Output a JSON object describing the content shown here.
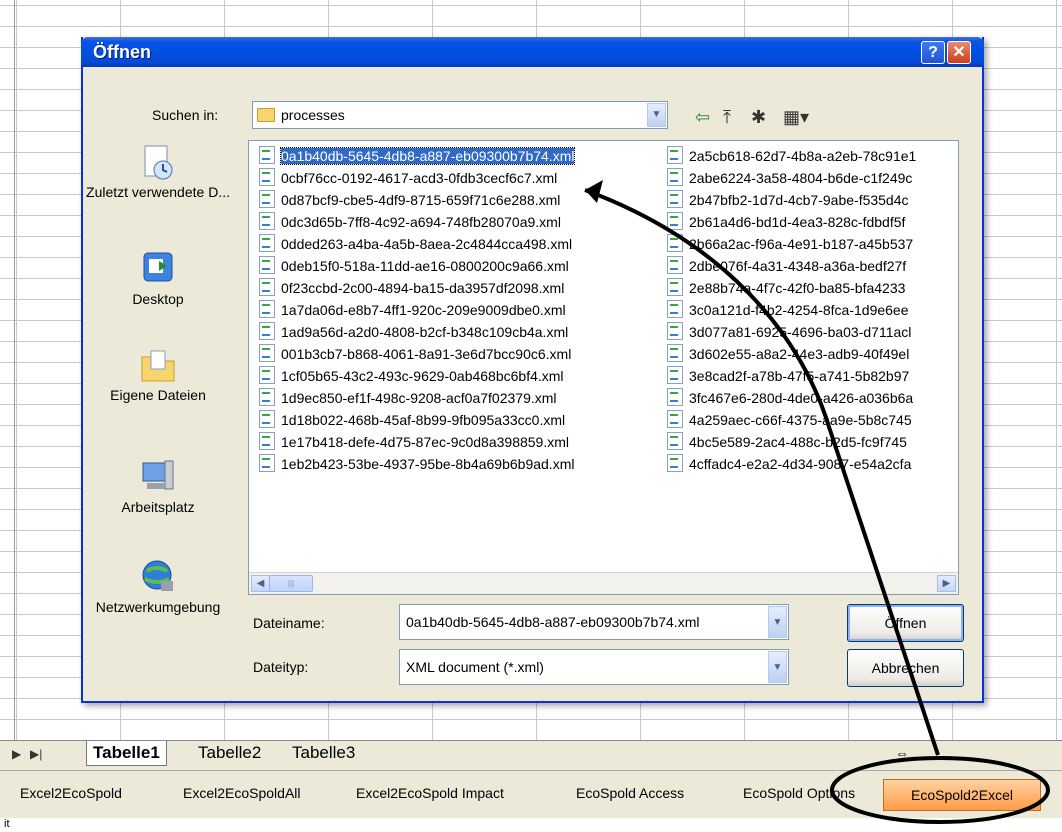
{
  "dialog": {
    "title": "Öffnen",
    "help_label": "?",
    "close_label": "✕",
    "look_in_label": "Suchen in:",
    "look_in_value": "processes",
    "filename_label": "Dateiname:",
    "filename_value": "0a1b40db-5645-4db8-a887-eb09300b7b74.xml",
    "filetype_label": "Dateityp:",
    "filetype_value": "XML document (*.xml)",
    "open_button": "Öffnen",
    "cancel_button": "Abbrechen"
  },
  "places": [
    {
      "label": "Zuletzt verwendete D...",
      "icon": "recent-documents-icon"
    },
    {
      "label": "Desktop",
      "icon": "desktop-icon"
    },
    {
      "label": "Eigene Dateien",
      "icon": "my-documents-icon"
    },
    {
      "label": "Arbeitsplatz",
      "icon": "my-computer-icon"
    },
    {
      "label": "Netzwerkumgebung",
      "icon": "network-icon"
    }
  ],
  "files_col1": [
    "0a1b40db-5645-4db8-a887-eb09300b7b74.xml",
    "0cbf76cc-0192-4617-acd3-0fdb3cecf6c7.xml",
    "0d87bcf9-cbe5-4df9-8715-659f71c6e288.xml",
    "0dc3d65b-7ff8-4c92-a694-748fb28070a9.xml",
    "0dded263-a4ba-4a5b-8aea-2c4844cca498.xml",
    "0deb15f0-518a-11dd-ae16-0800200c9a66.xml",
    "0f23ccbd-2c00-4894-ba15-da3957df2098.xml",
    "1a7da06d-e8b7-4ff1-920c-209e9009dbe0.xml",
    "1ad9a56d-a2d0-4808-b2cf-b348c109cb4a.xml",
    "001b3cb7-b868-4061-8a91-3e6d7bcc90c6.xml",
    "1cf05b65-43c2-493c-9629-0ab468bc6bf4.xml",
    "1d9ec850-ef1f-498c-9208-acf0a7f02379.xml",
    "1d18b022-468b-45af-8b99-9fb095a33cc0.xml",
    "1e17b418-defe-4d75-87ec-9c0d8a398859.xml",
    "1eb2b423-53be-4937-95be-8b4a69b6b9ad.xml"
  ],
  "files_col2": [
    "2a5cb618-62d7-4b8a-a2eb-78c91e1",
    "2abe6224-3a58-4804-b6de-c1f249c",
    "2b47bfb2-1d7d-4cb7-9abe-f535d4c",
    "2b61a4d6-bd1d-4ea3-828c-fdbdf5f",
    "2b66a2ac-f96a-4e91-b187-a45b537",
    "2dbe076f-4a31-4348-a36a-bedf27f",
    "2e88b74a-4f7c-42f0-ba85-bfa4233",
    "3c0a121d-f4b2-4254-8fca-1d9e6ee",
    "3d077a81-6925-4696-ba03-d711acl",
    "3d602e55-a8a2-44e3-adb9-40f49el",
    "3e8cad2f-a78b-47f5-a741-5b82b97",
    "3fc467e6-280d-4de0-a426-a036b6a",
    "4a259aec-c66f-4375-aa9e-5b8c745",
    "4bc5e589-2ac4-488c-b2d5-fc9f745",
    "4cffadc4-e2a2-4d34-9087-e54a2cfa"
  ],
  "sheet_tabs": [
    "Tabelle1",
    "Tabelle2",
    "Tabelle3"
  ],
  "macro_buttons": [
    "Excel2EcoSpold",
    "Excel2EcoSpoldAll",
    "Excel2EcoSpold Impact",
    "EcoSpold Access",
    "EcoSpold Options",
    "EcoSpold2Excel"
  ],
  "status_text": "it",
  "colors": {
    "selection": "#316ac5",
    "titlebar": "#0050e0",
    "highlight_button": "#ff9c4a"
  }
}
